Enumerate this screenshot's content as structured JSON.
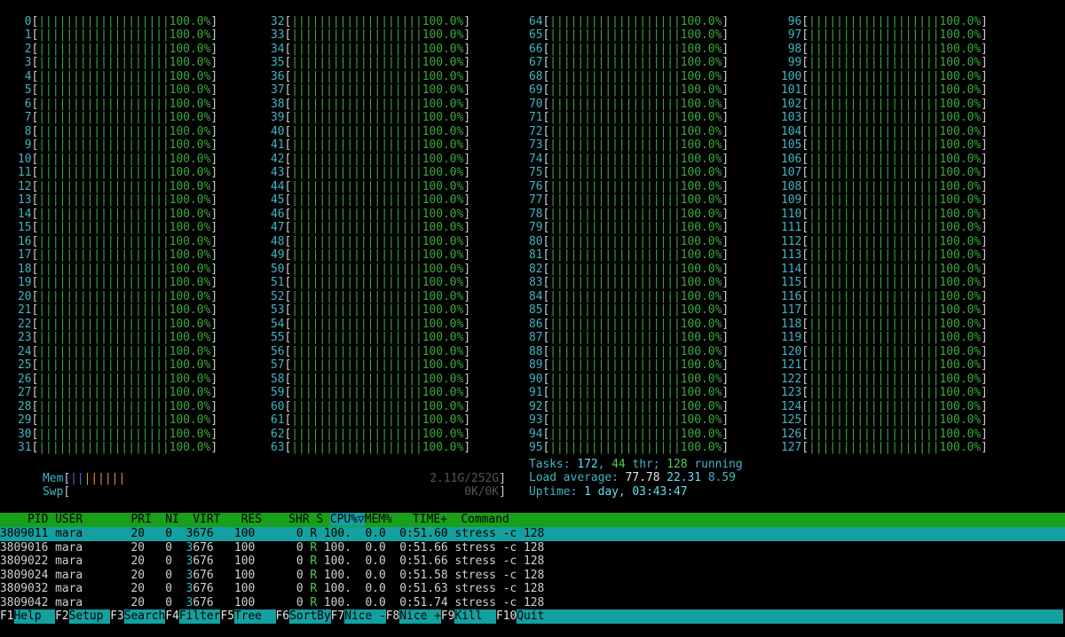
{
  "cpus": {
    "count": 128,
    "columns": 4,
    "per_column": 32,
    "bar": "|||||||||||||||||||",
    "percent": "100.0%"
  },
  "mem": {
    "label": "Mem",
    "bar_blue": "||",
    "bar_orange": "||||||",
    "value": "2.11G/252G"
  },
  "swp": {
    "label": "Swp",
    "value": "0K/0K"
  },
  "tasks": {
    "label": "Tasks:",
    "count": "172",
    "sep": ",",
    "threads": "44",
    "threads_label": "thr;",
    "running": "128",
    "running_label": "running"
  },
  "load": {
    "label": "Load average:",
    "one": "77.78",
    "five": "22.31",
    "fifteen": "8.59"
  },
  "uptime": {
    "label": "Uptime:",
    "value": "1 day, 03:43:47"
  },
  "table": {
    "headers": {
      "pid": "    PID",
      "user": "USER",
      "pri": "PRI",
      "ni": "NI",
      "virt": "VIRT",
      "res": "RES",
      "shr": "SHR",
      "s": "S",
      "cpu": "CPU%▽",
      "mem": "MEM%",
      "time": "TIME+",
      "command": "Command"
    },
    "rows": [
      {
        "pid": "3809011",
        "user": "mara",
        "pri": "20",
        "ni": "0",
        "virt_hi": "3",
        "virt_lo": "676",
        "res": "100",
        "shr": "0",
        "s": "R",
        "cpu": "100.",
        "mem": "0.0",
        "time": "0:51.60",
        "command": "stress -c 128"
      },
      {
        "pid": "3809016",
        "user": "mara",
        "pri": "20",
        "ni": "0",
        "virt_hi": "3",
        "virt_lo": "676",
        "res": "100",
        "shr": "0",
        "s": "R",
        "cpu": "100.",
        "mem": "0.0",
        "time": "0:51.66",
        "command": "stress -c 128"
      },
      {
        "pid": "3809022",
        "user": "mara",
        "pri": "20",
        "ni": "0",
        "virt_hi": "3",
        "virt_lo": "676",
        "res": "100",
        "shr": "0",
        "s": "R",
        "cpu": "100.",
        "mem": "0.0",
        "time": "0:51.66",
        "command": "stress -c 128"
      },
      {
        "pid": "3809024",
        "user": "mara",
        "pri": "20",
        "ni": "0",
        "virt_hi": "3",
        "virt_lo": "676",
        "res": "100",
        "shr": "0",
        "s": "R",
        "cpu": "100.",
        "mem": "0.0",
        "time": "0:51.58",
        "command": "stress -c 128"
      },
      {
        "pid": "3809032",
        "user": "mara",
        "pri": "20",
        "ni": "0",
        "virt_hi": "3",
        "virt_lo": "676",
        "res": "100",
        "shr": "0",
        "s": "R",
        "cpu": "100.",
        "mem": "0.0",
        "time": "0:51.63",
        "command": "stress -c 128"
      },
      {
        "pid": "3809042",
        "user": "mara",
        "pri": "20",
        "ni": "0",
        "virt_hi": "3",
        "virt_lo": "676",
        "res": "100",
        "shr": "0",
        "s": "R",
        "cpu": "100.",
        "mem": "0.0",
        "time": "0:51.74",
        "command": "stress -c 128"
      }
    ]
  },
  "fkeys": [
    {
      "key": "F1",
      "label": "Help  "
    },
    {
      "key": "F2",
      "label": "Setup "
    },
    {
      "key": "F3",
      "label": "Search"
    },
    {
      "key": "F4",
      "label": "Filter"
    },
    {
      "key": "F5",
      "label": "Tree  "
    },
    {
      "key": "F6",
      "label": "SortBy"
    },
    {
      "key": "F7",
      "label": "Nice -"
    },
    {
      "key": "F8",
      "label": "Nice +"
    },
    {
      "key": "F9",
      "label": "Kill  "
    },
    {
      "key": "F10",
      "label": "Quit"
    }
  ],
  "colors": {
    "background": "#000000",
    "meter_green": "#3caa3c",
    "cpu_number_cyan": "#3fb7c8",
    "header_green": "#18a018",
    "selection_cyan": "#14a0a0"
  }
}
